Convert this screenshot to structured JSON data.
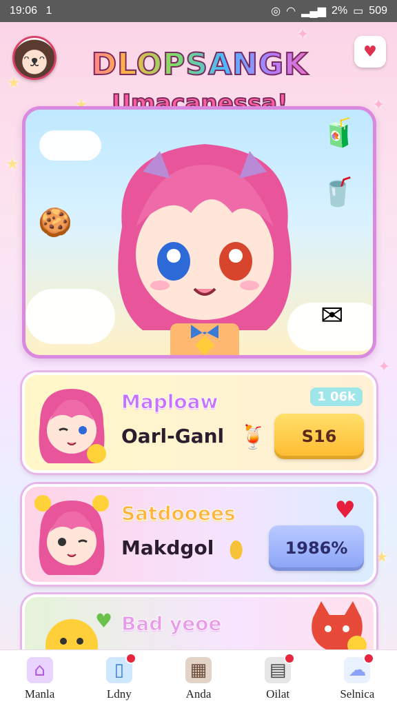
{
  "status_bar": {
    "time": "19:06",
    "sim_indicator": "1",
    "battery_percent": "2%",
    "battery_text": "509"
  },
  "header": {
    "title": "DLOPSANGK",
    "subtitle": "Umacanessa!"
  },
  "cards": [
    {
      "title": "Maploaw",
      "name": "Oarl-Ganl",
      "badge": "1 06k",
      "button_label": "S16",
      "item_icon": "drink-icon"
    },
    {
      "title": "Satdooees",
      "name": "Makdgol",
      "button_label": "1986%",
      "item_icon": "crystal-icon"
    },
    {
      "title": "Bad yeoe",
      "name": ""
    }
  ],
  "bottom_nav": [
    {
      "label": "Manla",
      "icon": "home-icon",
      "badge": false
    },
    {
      "label": "Ldny",
      "icon": "phone-icon",
      "badge": true
    },
    {
      "label": "Anda",
      "icon": "gallery-icon",
      "badge": false
    },
    {
      "label": "Oilat",
      "icon": "calendar-icon",
      "badge": true
    },
    {
      "label": "Selnica",
      "icon": "cloud-icon",
      "badge": true
    }
  ],
  "colors": {
    "accent_pink": "#ff5fa0",
    "badge_red": "#e8253c",
    "gold_button": "#ffb92e",
    "blue_button": "#8aa3f7"
  }
}
